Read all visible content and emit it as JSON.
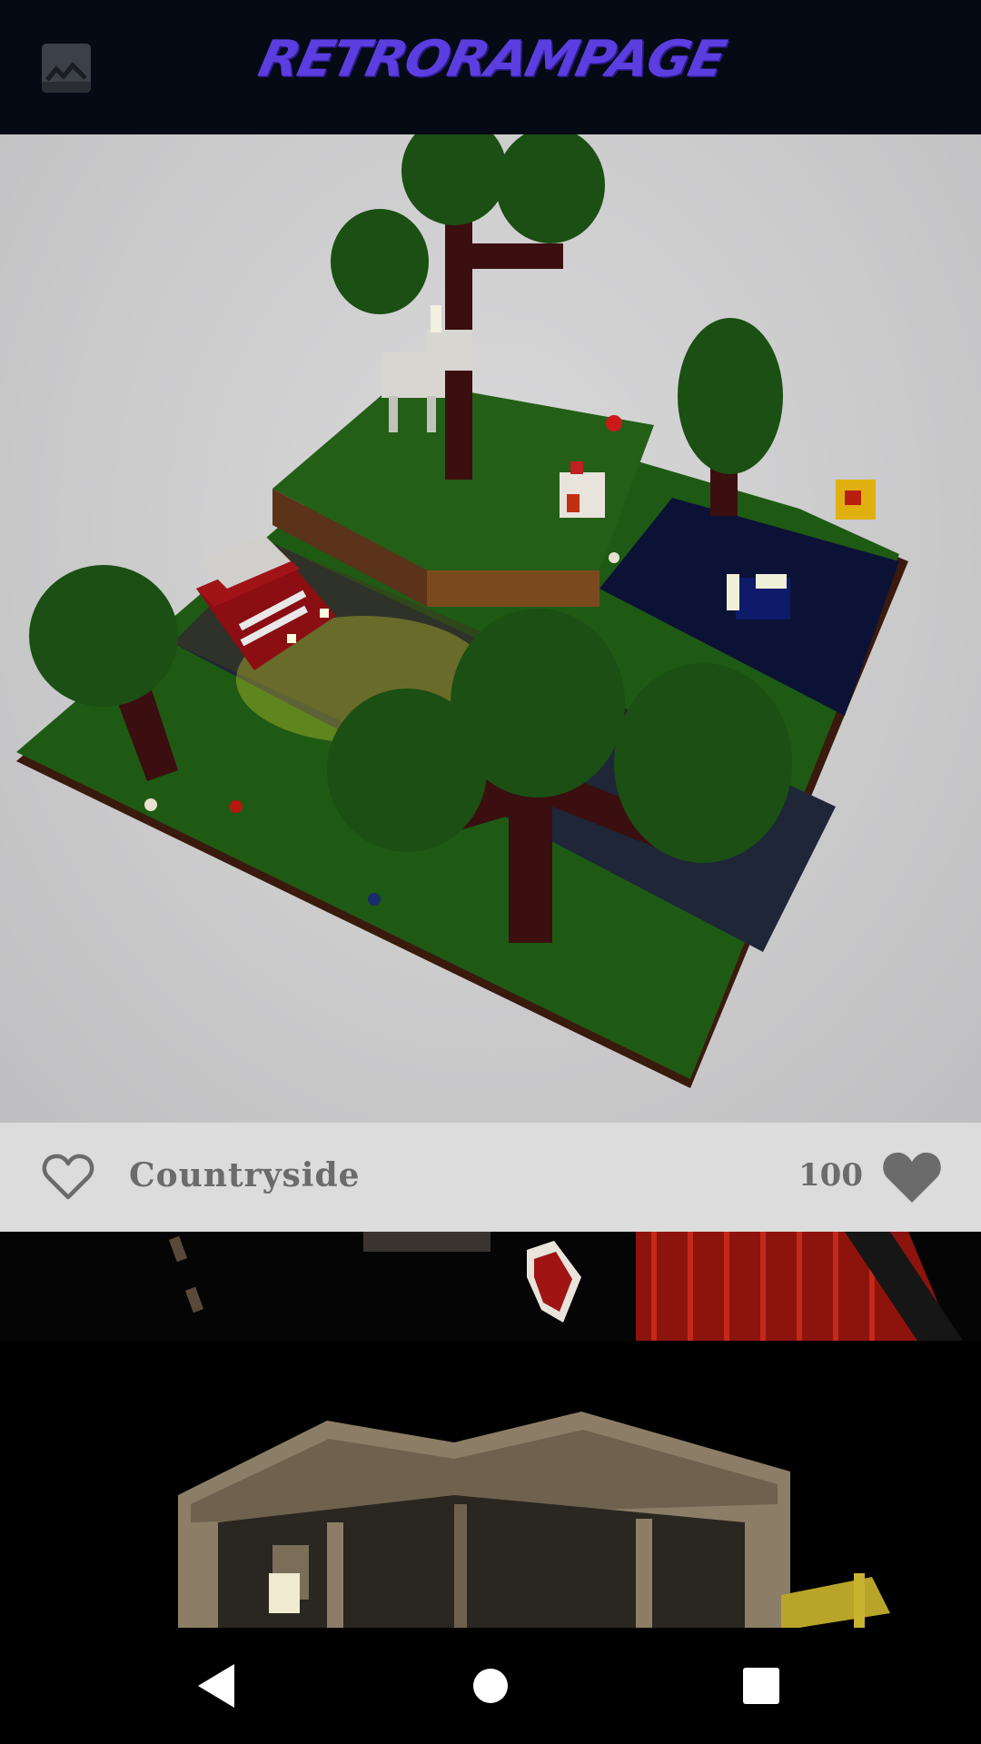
{
  "app": {
    "title": "RETRORAMPAGE",
    "brand_color": "#5b3ee0",
    "header_bg": "#060a14"
  },
  "header": {
    "gallery_icon": "gallery-image-icon"
  },
  "feed": {
    "items": [
      {
        "title": "Countryside",
        "likes": "100",
        "liked_icon": "heart-outline-icon",
        "count_icon": "heart-filled-icon"
      }
    ]
  },
  "navigation": {
    "back_icon": "triangle-back-icon",
    "home_icon": "circle-home-icon",
    "recents_icon": "square-recents-icon"
  }
}
